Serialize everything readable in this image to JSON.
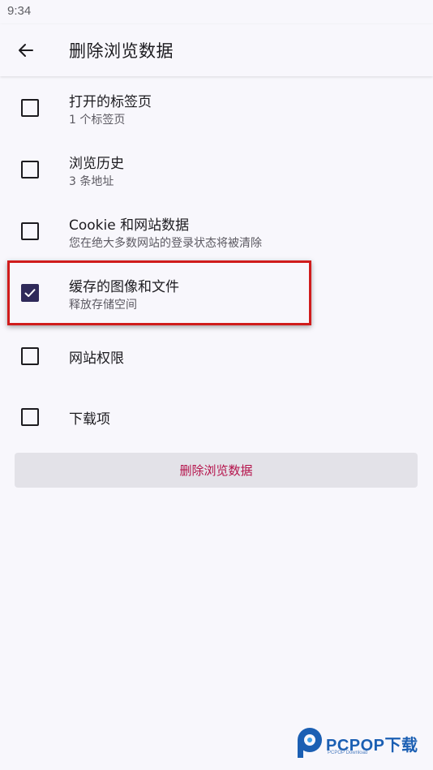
{
  "status_bar": {
    "time": "9:34"
  },
  "app_bar": {
    "title": "删除浏览数据",
    "back_icon": "arrow-left-icon"
  },
  "items": [
    {
      "title": "打开的标签页",
      "subtitle": "1 个标签页",
      "checked": false
    },
    {
      "title": "浏览历史",
      "subtitle": "3 条地址",
      "checked": false
    },
    {
      "title": "Cookie 和网站数据",
      "subtitle": "您在绝大多数网站的登录状态将被清除",
      "checked": false
    },
    {
      "title": "缓存的图像和文件",
      "subtitle": "释放存储空间",
      "checked": true
    },
    {
      "title": "网站权限",
      "subtitle": "",
      "checked": false
    },
    {
      "title": "下载项",
      "subtitle": "",
      "checked": false
    }
  ],
  "delete_button": {
    "label": "删除浏览数据"
  },
  "watermark": {
    "brand": "PCPOP下载",
    "tagline": "PCPOP Download"
  },
  "colors": {
    "background": "#f8f7fc",
    "checkbox_checked": "#2f2a5a",
    "button_bg": "#e3e2e8",
    "button_text": "#b5134b",
    "highlight": "#d01c1c",
    "watermark_blue": "#1b5fb3"
  }
}
